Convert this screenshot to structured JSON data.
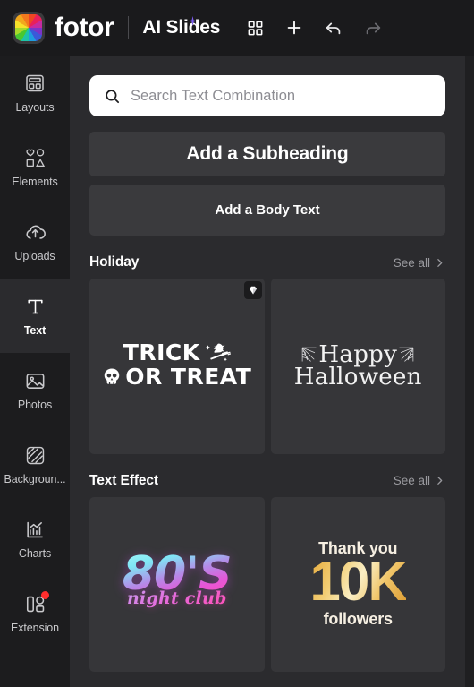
{
  "topbar": {
    "logo_name": "fotor-logo",
    "brand": "fotor",
    "app_title": "AI Slides",
    "actions": [
      {
        "name": "grid-view-button",
        "icon": "grid-icon",
        "label": "Grid view"
      },
      {
        "name": "add-slide-button",
        "icon": "plus-icon",
        "label": "Add"
      },
      {
        "name": "undo-button",
        "icon": "undo-arrow-icon",
        "label": "Undo"
      },
      {
        "name": "redo-button",
        "icon": "redo-arrow-icon",
        "label": "Redo"
      }
    ]
  },
  "sidebar": {
    "items": [
      {
        "label": "Layouts",
        "icon": "layouts-icon",
        "active": false,
        "badge": false
      },
      {
        "label": "Elements",
        "icon": "elements-icon",
        "active": false,
        "badge": false
      },
      {
        "label": "Uploads",
        "icon": "upload-cloud-icon",
        "active": false,
        "badge": false
      },
      {
        "label": "Text",
        "icon": "text-t-icon",
        "active": true,
        "badge": false
      },
      {
        "label": "Photos",
        "icon": "photo-icon",
        "active": false,
        "badge": false
      },
      {
        "label": "Backgroun...",
        "icon": "background-icon",
        "active": false,
        "badge": false
      },
      {
        "label": "Charts",
        "icon": "charts-icon",
        "active": false,
        "badge": false
      },
      {
        "label": "Extension",
        "icon": "extension-icon",
        "active": false,
        "badge": true
      }
    ]
  },
  "panel": {
    "search": {
      "placeholder": "Search Text Combination",
      "value": "",
      "icon": "search-icon"
    },
    "quick_text": {
      "subheading_label": "Add a Subheading",
      "body_label": "Add a Body Text"
    },
    "sections": [
      {
        "title": "Holiday",
        "see_all": "See all",
        "cards": [
          {
            "name": "trick-or-treat",
            "premium": true,
            "line1": "TRICK",
            "line2": "OR TREAT"
          },
          {
            "name": "happy-halloween",
            "premium": false,
            "line1": "Happy",
            "line2": "Halloween"
          }
        ]
      },
      {
        "title": "Text Effect",
        "see_all": "See all",
        "cards": [
          {
            "name": "eighties-night-club",
            "premium": false,
            "line1": "80'S",
            "line2": "night club"
          },
          {
            "name": "thank-you-10k-followers",
            "premium": false,
            "line1": "Thank you",
            "line2": "10K",
            "line3": "followers"
          }
        ]
      }
    ]
  },
  "colors": {
    "topbar_bg": "#1a1a1c",
    "sidebar_bg": "#1c1c1e",
    "panel_bg": "#2b2b2e",
    "card_bg": "#363639",
    "button_bg": "#3a3a3d",
    "accent_purple": "#7b5cf0",
    "badge_red": "#ff2d2d",
    "text_primary": "#ffffff",
    "text_muted": "#9a9a9f"
  }
}
